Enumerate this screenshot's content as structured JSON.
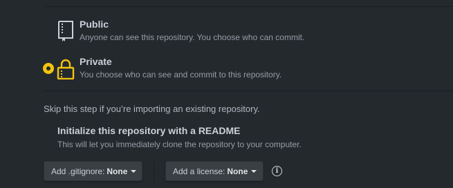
{
  "visibility": {
    "options": [
      {
        "title": "Public",
        "description": "Anyone can see this repository. You choose who can commit.",
        "icon": "repo-book-icon",
        "selected": false
      },
      {
        "title": "Private",
        "description": "You choose who can see and commit to this repository.",
        "icon": "lock-icon",
        "selected": true
      }
    ]
  },
  "init": {
    "skip_text": "Skip this step if you’re importing an existing repository.",
    "readme_title": "Initialize this repository with a README",
    "readme_desc": "This will let you immediately clone the repository to your computer."
  },
  "gitignore": {
    "label": "Add .gitignore:",
    "value": "None"
  },
  "license": {
    "label": "Add a license:",
    "value": "None"
  },
  "info_icon": {
    "icon": "info-icon",
    "glyph": "i"
  },
  "colors": {
    "accent": "#f1c40f",
    "background": "#24292e",
    "button": "#3a3f44"
  }
}
